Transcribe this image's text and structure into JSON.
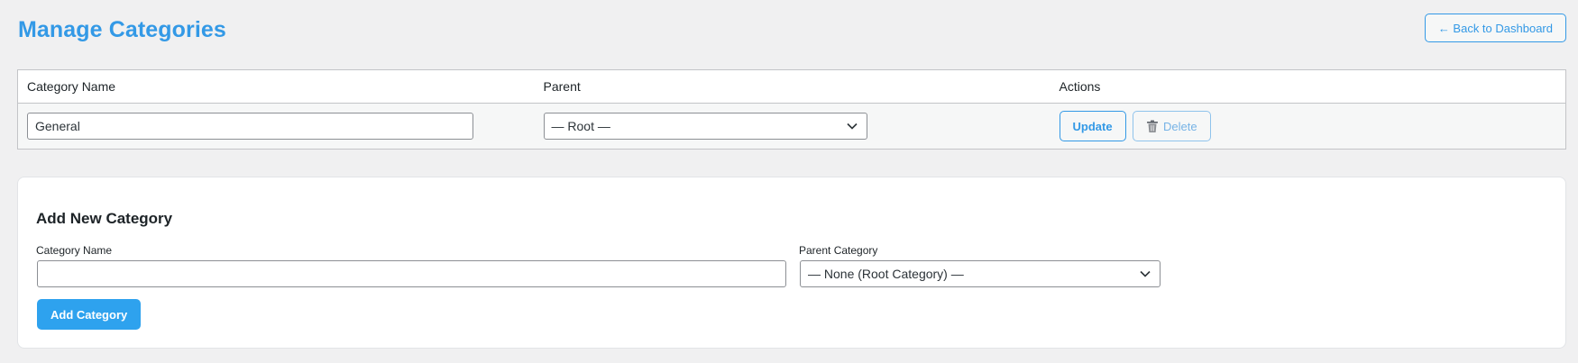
{
  "header": {
    "title": "Manage Categories",
    "back_label": "← Back to Dashboard"
  },
  "table": {
    "columns": [
      "Category Name",
      "Parent",
      "Actions"
    ],
    "rows": [
      {
        "name": "General",
        "parent": "— Root —",
        "update_label": "Update",
        "delete_label": "Delete"
      }
    ]
  },
  "add_form": {
    "heading": "Add New Category",
    "name_label": "Category Name",
    "name_value": "",
    "parent_label": "Parent Category",
    "parent_value": "— None (Root Category) —",
    "submit_label": "Add Category"
  },
  "icons": {
    "select_arrow": "chevron-down-icon",
    "delete": "trash-icon"
  },
  "colors": {
    "accent": "#3399e6",
    "primary_button": "#2ea2ee",
    "background": "#f0f0f1"
  }
}
